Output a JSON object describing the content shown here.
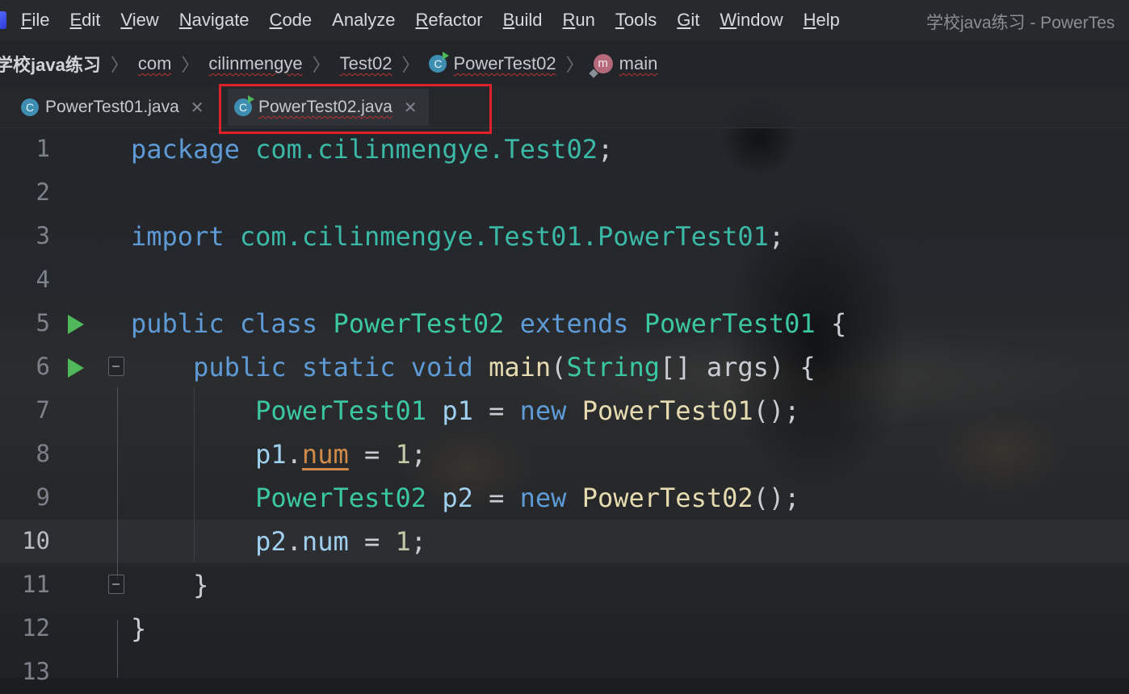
{
  "menu": {
    "items": [
      {
        "mnemonic": "F",
        "rest": "ile"
      },
      {
        "mnemonic": "E",
        "rest": "dit"
      },
      {
        "mnemonic": "V",
        "rest": "iew"
      },
      {
        "mnemonic": "N",
        "rest": "avigate"
      },
      {
        "mnemonic": "C",
        "rest": "ode"
      },
      {
        "mnemonic": "",
        "rest": "Analyze"
      },
      {
        "mnemonic": "R",
        "rest": "efactor"
      },
      {
        "mnemonic": "B",
        "rest": "uild"
      },
      {
        "mnemonic": "R",
        "rest": "un"
      },
      {
        "mnemonic": "T",
        "rest": "ools"
      },
      {
        "mnemonic": "G",
        "rest": "it"
      },
      {
        "mnemonic": "W",
        "rest": "indow"
      },
      {
        "mnemonic": "H",
        "rest": "elp"
      }
    ],
    "window_title": "学校java练习 - PowerTes"
  },
  "breadcrumb": {
    "project": "学校java练习",
    "pkg1": "com",
    "pkg2": "cilinmengye",
    "pkg3": "Test02",
    "class": "PowerTest02",
    "method": "main",
    "class_icon": "class-icon",
    "method_icon": "method-icon"
  },
  "tabs": [
    {
      "label": "PowerTest01.java",
      "icon": "class-icon",
      "active": false
    },
    {
      "label": "PowerTest02.java",
      "icon": "class-run-icon",
      "active": true
    }
  ],
  "editor": {
    "current_line": 10,
    "line_numbers": [
      "1",
      "2",
      "3",
      "4",
      "5",
      "6",
      "7",
      "8",
      "9",
      "10",
      "11",
      "12",
      "13"
    ],
    "code": {
      "l1": {
        "kw": "package",
        "pkg": "com.cilinmengye.Test02",
        "end": ";"
      },
      "l3": {
        "kw": "import",
        "pkg": "com.cilinmengye.Test01.PowerTest01",
        "end": ";"
      },
      "l5": {
        "kw1": "public",
        "kw2": "class",
        "name": "PowerTest02",
        "kw3": "extends",
        "parent": "PowerTest01",
        "end": "{"
      },
      "l6": {
        "kw1": "public",
        "kw2": "static",
        "kw3": "void",
        "method": "main",
        "open": "(",
        "type": "String",
        "rest": "[] args) {"
      },
      "l7": {
        "type": "PowerTest01",
        "var": "p1",
        "eq": "=",
        "kw": "new",
        "ctor": "PowerTest01",
        "end": "();"
      },
      "l8": {
        "var": "p1",
        "dot": ".",
        "field": "num",
        "eq": "=",
        "num": "1",
        "end": ";"
      },
      "l9": {
        "type": "PowerTest02",
        "var": "p2",
        "eq": "=",
        "kw": "new",
        "ctor": "PowerTest02",
        "end": "();"
      },
      "l10": {
        "var": "p2",
        "dot": ".",
        "field": "num",
        "eq": "=",
        "num": "1",
        "end": ";"
      },
      "l11": {
        "end": "}"
      },
      "l12": {
        "end": "}"
      }
    }
  }
}
